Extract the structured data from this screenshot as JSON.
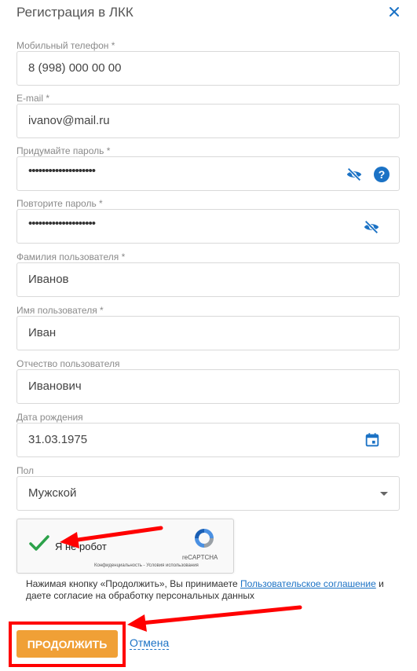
{
  "dialog": {
    "title": "Регистрация в ЛКК"
  },
  "fields": {
    "phone": {
      "label": "Мобильный телефон *",
      "value": "8 (998) 000 00 00"
    },
    "email": {
      "label": "E-mail *",
      "value": "ivanov@mail.ru"
    },
    "password": {
      "label": "Придумайте пароль *",
      "value": "••••••••••••••••••••"
    },
    "password_repeat": {
      "label": "Повторите пароль *",
      "value": "••••••••••••••••••••"
    },
    "last_name": {
      "label": "Фамилия пользователя *",
      "value": "Иванов"
    },
    "first_name": {
      "label": "Имя пользователя *",
      "value": "Иван"
    },
    "middle_name": {
      "label": "Отчество пользователя",
      "value": "Иванович"
    },
    "birth_date": {
      "label": "Дата рождения",
      "value": "31.03.1975"
    },
    "gender": {
      "label": "Пол",
      "value": "Мужской"
    }
  },
  "captcha": {
    "label": "Я не робот",
    "brand": "reCAPTCHA",
    "links": "Конфиденциальность - Условия использования"
  },
  "consent": {
    "text_before": "Нажимая кнопку «Продолжить», Вы принимаете ",
    "link": "Пользовательское соглашение",
    "text_after": " и даете согласие на обработку персональных данных"
  },
  "actions": {
    "continue_label": "ПРОДОЛЖИТЬ",
    "cancel_label": "Отмена"
  },
  "colors": {
    "accent": "#1b72c5",
    "button": "#f0a036",
    "annotation": "#ff0000",
    "check": "#2ca24a"
  },
  "icons": {
    "close": "close-icon",
    "eye_off": "eye-off-icon",
    "help": "help-icon",
    "calendar": "calendar-icon",
    "dropdown": "chevron-down-icon",
    "check": "checkmark-icon",
    "recaptcha": "recaptcha-logo"
  }
}
